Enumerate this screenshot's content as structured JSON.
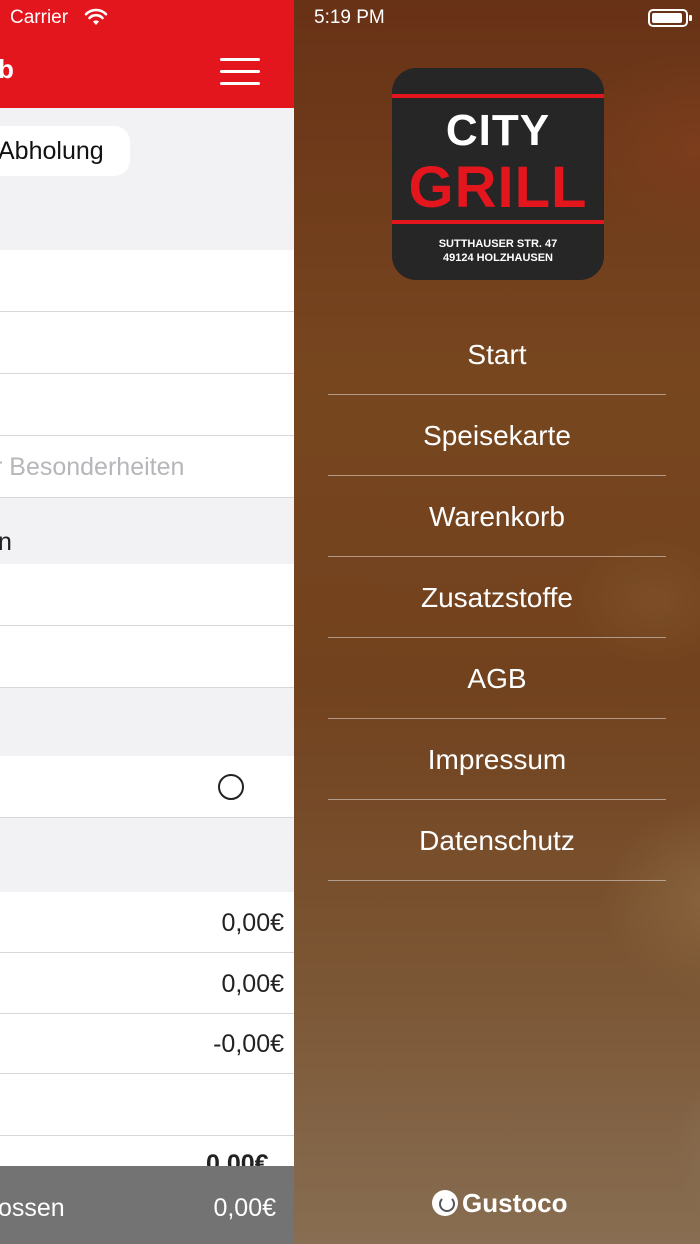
{
  "status_bar": {
    "carrier": "Carrier",
    "time": "5:19 PM"
  },
  "cart": {
    "title_fragment": "b",
    "pickup_option": "Abholung",
    "notes_placeholder": "r Besonderheiten",
    "section_fragment": "n",
    "line_items": [
      {
        "price": "0,00€"
      },
      {
        "price": "0,00€"
      },
      {
        "price": "-0,00€"
      }
    ],
    "total_partial": "0,00€",
    "footer_label": "ossen",
    "footer_total": "0,00€"
  },
  "logo": {
    "line1": "CITY",
    "line2": "GRILL",
    "address1": "SUTTHAUSER STR. 47",
    "address2": "49124 HOLZHAUSEN"
  },
  "menu": {
    "items": [
      {
        "label": "Start"
      },
      {
        "label": "Speisekarte"
      },
      {
        "label": "Warenkorb"
      },
      {
        "label": "Zusatzstoffe"
      },
      {
        "label": "AGB"
      },
      {
        "label": "Impressum"
      },
      {
        "label": "Datenschutz"
      }
    ]
  },
  "branding": {
    "powered_by": "Gustoco"
  },
  "colors": {
    "brand_red": "#e3161e",
    "footer_grey": "#737373"
  },
  "icons": [
    "wifi-icon",
    "menu-burger-icon",
    "battery-icon",
    "radio-unchecked-icon",
    "gustoco-logo-icon"
  ]
}
